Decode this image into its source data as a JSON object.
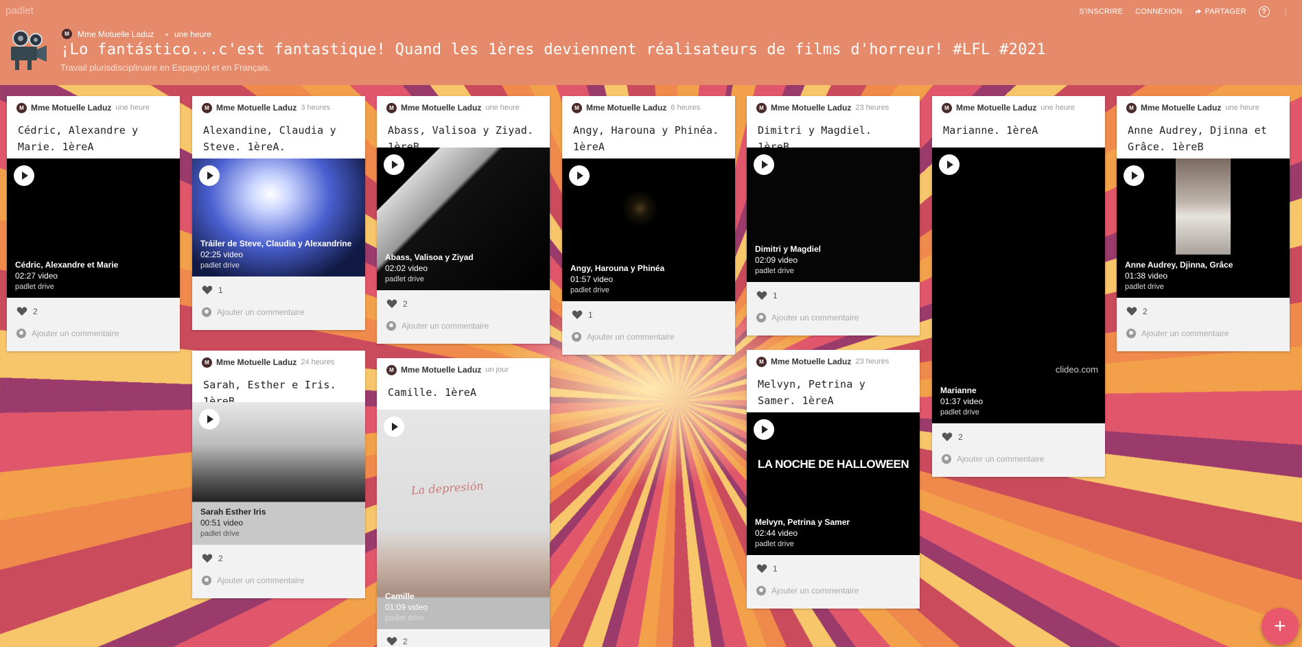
{
  "app": {
    "brand": "padlet"
  },
  "topnav": {
    "signup": "S'INSCRIRE",
    "login": "CONNEXION",
    "share": "PARTAGER",
    "help": "?"
  },
  "board": {
    "author": "Mme Motuelle Laduz",
    "author_initial": "M",
    "time": "une heure",
    "title": "¡Lo fantástico...c'est fantastique! Quand les 1ères deviennent réalisateurs de films d'horreur! #LFL #2021",
    "subtitle": "Travail plurisdisciplinaire en Espagnol et en Français."
  },
  "comment_placeholder": "Ajouter un commentaire",
  "cards": [
    {
      "author": "Mme Motuelle Laduz",
      "time": "une heure",
      "title": "Cédric, Alexandre y Marie. 1èreA",
      "video_title": "Cédric, Alexandre et Marie",
      "video_meta": "02:27 video",
      "video_source": "padlet drive",
      "likes": "2"
    },
    {
      "author": "Mme Motuelle Laduz",
      "time": "3 heures",
      "title": "Alexandine, Claudia y Steve. 1èreA.",
      "video_title": "Tráiler de Steve, Claudia y Alexandrine",
      "video_meta": "02:25 video",
      "video_source": "padlet drive",
      "likes": "1"
    },
    {
      "author": "Mme Motuelle Laduz",
      "time": "24 heures",
      "title": "Sarah, Esther e Iris. 1èreB",
      "video_title": "Sarah Esther Iris",
      "video_meta": "00:51 video",
      "video_source": "padlet drive",
      "likes": "2"
    },
    {
      "author": "Mme Motuelle Laduz",
      "time": "une heure",
      "title": "Abass, Valisoa y Ziyad. 1èreB",
      "video_title": "Abass, Valisoa y Ziyad",
      "video_meta": "02:02 video",
      "video_source": "padlet drive",
      "likes": "2"
    },
    {
      "author": "Mme Motuelle Laduz",
      "time": "un jour",
      "title": "Camille. 1èreA",
      "video_title": "Camille",
      "video_meta": "01:09 video",
      "video_source": "padlet drive",
      "likes": "2",
      "handwriting": "La depresión"
    },
    {
      "author": "Mme Motuelle Laduz",
      "time": "6 heures",
      "title": "Angy, Harouna y Phinéa. 1èreA",
      "video_title": "Angy, Harouna y Phinéa",
      "video_meta": "01:57 video",
      "video_source": "padlet drive",
      "likes": "1"
    },
    {
      "author": "Mme Motuelle Laduz",
      "time": "23 heures",
      "title": "Dimitri y Magdiel. 1èreB",
      "video_title": "Dimitri y Magdiel",
      "video_meta": "02:09 video",
      "video_source": "padlet drive",
      "likes": "1"
    },
    {
      "author": "Mme Motuelle Laduz",
      "time": "23 heures",
      "title": "Melvyn, Petrina y Samer. 1èreA",
      "video_title": "Melvyn, Petrina y Samer",
      "video_meta": "02:44 video",
      "video_source": "padlet drive",
      "likes": "1",
      "overlay": "LA NOCHE DE HALLOWEEN"
    },
    {
      "author": "Mme Motuelle Laduz",
      "time": "une heure",
      "title": "Marianne. 1èreA",
      "video_title": "Marianne",
      "video_meta": "01:37 video",
      "video_source": "padlet drive",
      "likes": "2",
      "watermark": "clideo.com"
    },
    {
      "author": "Mme Motuelle Laduz",
      "time": "une heure",
      "title": "Anne Audrey, Djinna et Grâce. 1èreB",
      "video_title": "Anne Audrey, Djinna, Grâce",
      "video_meta": "01:38 video",
      "video_source": "padlet drive",
      "likes": "2"
    }
  ]
}
